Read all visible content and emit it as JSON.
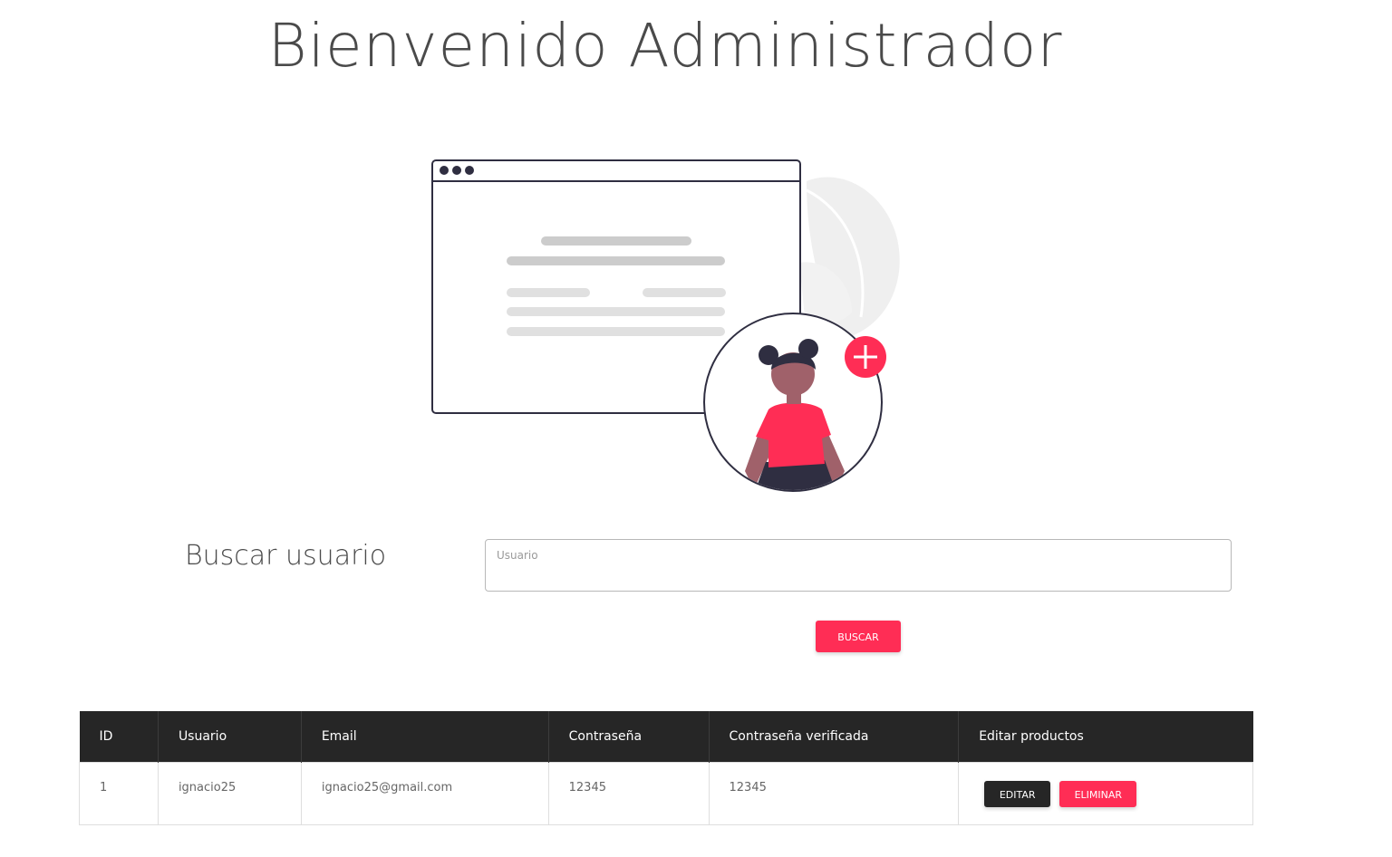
{
  "header": {
    "title": "Bienvenido Administrador"
  },
  "illustration": {
    "icon": "add-user-illustration",
    "accent_color": "#ff2d55",
    "dark_color": "#2f2e41"
  },
  "search": {
    "label": "Buscar usuario",
    "placeholder": "Usuario",
    "value": "",
    "button_label": "BUSCAR"
  },
  "table": {
    "columns": [
      "ID",
      "Usuario",
      "Email",
      "Contraseña",
      "Contraseña verificada",
      "Editar productos"
    ],
    "rows": [
      {
        "id": "1",
        "usuario": "ignacio25",
        "email": "ignacio25@gmail.com",
        "contrasena": "12345",
        "contrasena_verificada": "12345",
        "edit_label": "EDITAR",
        "delete_label": "ELIMINAR"
      }
    ]
  },
  "colors": {
    "accent": "#ff2d55",
    "header_bg": "#262626",
    "text": "#4a4a4a"
  }
}
